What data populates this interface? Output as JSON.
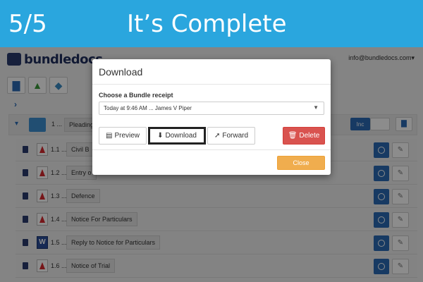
{
  "banner": {
    "step": "5/5",
    "headline": "It’s Complete"
  },
  "app": {
    "logo_text": "bundledocs",
    "user_email": "info@bundledocs.com",
    "caret": "▾",
    "breadcrumb_chevron": "›"
  },
  "folder": {
    "toggle": "▾",
    "number": "1 ...",
    "name": "Pleadings",
    "inc_label": "Inc"
  },
  "documents": [
    {
      "number": "1.1 ...",
      "name": "Civil B",
      "type": "pdf"
    },
    {
      "number": "1.2 ...",
      "name": "Entry o",
      "type": "pdf"
    },
    {
      "number": "1.3 ...",
      "name": "Defence",
      "type": "pdf"
    },
    {
      "number": "1.4 ...",
      "name": "Notice For Particulars",
      "type": "pdf"
    },
    {
      "number": "1.5 ...",
      "name": "Reply to Notice for Particulars",
      "type": "word"
    },
    {
      "number": "1.6 ...",
      "name": "Notice of Trial",
      "type": "pdf"
    }
  ],
  "modal": {
    "title": "Download",
    "choose_label": "Choose a Bundle receipt",
    "selected_receipt": "Today at 9:46 AM ... James V Piper",
    "preview_label": "Preview",
    "download_label": "Download",
    "forward_label": "Forward",
    "delete_label": "Delete",
    "close_label": "Close"
  },
  "icons": {
    "preview": "▤",
    "download": "⬇",
    "forward": "➚",
    "delete": "🗑",
    "caret": "▼",
    "word": "W"
  }
}
